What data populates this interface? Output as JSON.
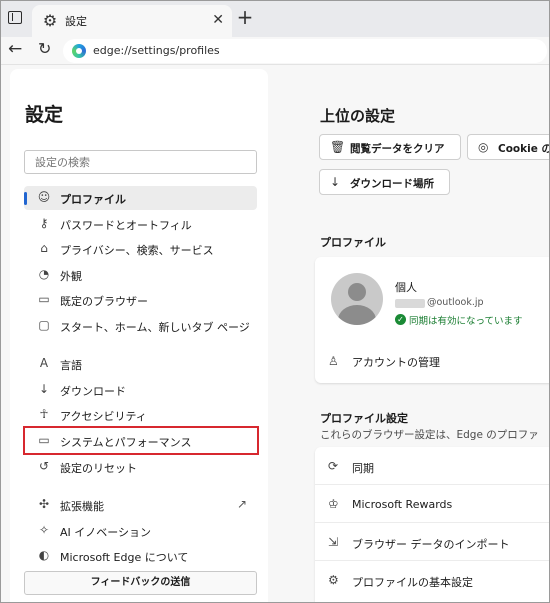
{
  "browser": {
    "tab_title": "設定",
    "url": "edge://settings/profiles"
  },
  "sidebar": {
    "title": "設定",
    "search_placeholder": "設定の検索",
    "items": [
      {
        "label": "プロファイル",
        "icon": "profile-icon"
      },
      {
        "label": "パスワードとオートフィル",
        "icon": "key-icon"
      },
      {
        "label": "プライバシー、検索、サービス",
        "icon": "lock-icon"
      },
      {
        "label": "外観",
        "icon": "palette-icon"
      },
      {
        "label": "既定のブラウザー",
        "icon": "browser-icon"
      },
      {
        "label": "スタート、ホーム、新しいタブ ページ",
        "icon": "home-icon"
      },
      {
        "label": "言語",
        "icon": "language-icon"
      },
      {
        "label": "ダウンロード",
        "icon": "download-icon"
      },
      {
        "label": "アクセシビリティ",
        "icon": "accessibility-icon"
      },
      {
        "label": "システムとパフォーマンス",
        "icon": "laptop-icon"
      },
      {
        "label": "設定のリセット",
        "icon": "reset-icon"
      },
      {
        "label": "拡張機能",
        "icon": "extensions-icon"
      },
      {
        "label": "AI イノベーション",
        "icon": "ai-icon"
      },
      {
        "label": "Microsoft Edge について",
        "icon": "edge-icon"
      }
    ],
    "feedback_label": "フィードバックの送信"
  },
  "main": {
    "top_title": "上位の設定",
    "buttons": {
      "clear_data": "閲覧データをクリア",
      "cookie": "Cookie の",
      "download_location": "ダウンロード場所"
    },
    "profile_section_title": "プロファイル",
    "profile": {
      "name": "個人",
      "email": "@outlook.jp",
      "sync_status": "同期は有効になっています",
      "manage_account": "アカウントの管理"
    },
    "profile_settings_title": "プロファイル設定",
    "profile_settings_desc": "これらのブラウザー設定は、Edge のプロファ",
    "settings_rows": [
      {
        "label": "同期",
        "icon": "sync-icon"
      },
      {
        "label": "Microsoft Rewards",
        "icon": "rewards-icon"
      },
      {
        "label": "ブラウザー データのインポート",
        "icon": "import-icon"
      },
      {
        "label": "プロファイルの基本設定",
        "icon": "preferences-icon"
      }
    ]
  },
  "colors": {
    "highlight": "#d7282f",
    "accent": "#2165d0",
    "sync_green": "#1a7d31"
  }
}
